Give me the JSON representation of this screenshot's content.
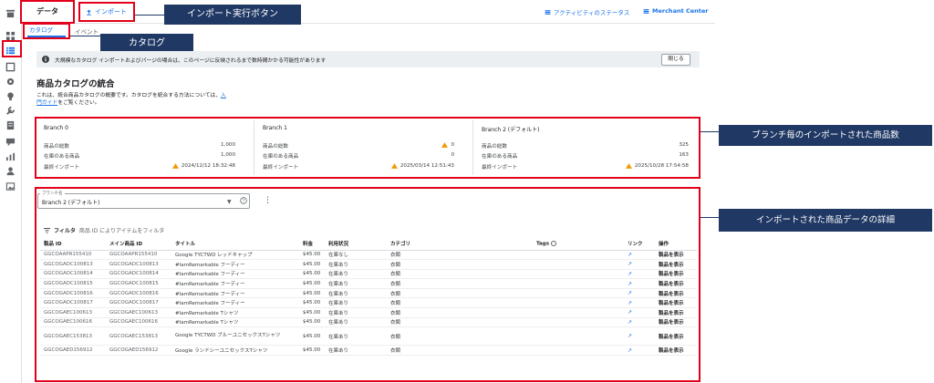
{
  "rail": {
    "icons": [
      "store-icon",
      "list-icon",
      "inbox-icon",
      "gear-icon",
      "lightbulb-icon",
      "wrench-icon",
      "document-icon",
      "chat-icon",
      "chart-icon",
      "person-icon",
      "image-icon"
    ]
  },
  "header": {
    "title": "データ",
    "import_label": "インポート",
    "activity_status": "アクティビティのステータス",
    "merchant_center": "Merchant Center"
  },
  "tabs": [
    {
      "label": "カタログ"
    },
    {
      "label": "イベント"
    }
  ],
  "callouts": {
    "import": "インポート実行ボタン",
    "catalog": "カタログ",
    "branch": "ブランチ毎のインポートされた商品数",
    "detail": "インポートされた商品データの詳細"
  },
  "banner": {
    "text": "大規模なカタログ インポートおよびパージの場合は、このページに反映されるまで数時間かかる可能性があります",
    "close": "閉じる"
  },
  "section": {
    "title": "商品カタログの統合",
    "desc_prefix": "これは、統合商品カタログの概要です。カタログを統合する方法については、",
    "link1": "入",
    "link2": "門ガイド",
    "desc_suffix": "をご覧ください。"
  },
  "branches": [
    {
      "name": "Branch 0",
      "total_label": "商品の総数",
      "total": "1,000",
      "instock_label": "在庫のある商品",
      "instock": "1,000",
      "last_label": "最終インポート",
      "last": "2024/12/12 18:32:48",
      "total_warn": false,
      "last_warn": true
    },
    {
      "name": "Branch 1",
      "total_label": "商品の総数",
      "total": "0",
      "instock_label": "在庫のある商品",
      "instock": "0",
      "last_label": "最終インポート",
      "last": "2025/03/14 12:51:43",
      "total_warn": true,
      "last_warn": true
    },
    {
      "name": "Branch 2 (デフォルト)",
      "total_label": "商品の総数",
      "total": "325",
      "instock_label": "在庫のある商品",
      "instock": "163",
      "last_label": "最終インポート",
      "last": "2025/10/28 17:54:58",
      "total_warn": false,
      "last_warn": true
    }
  ],
  "selector": {
    "label": "ブランチ名",
    "value": "Branch 2 (デフォルト)"
  },
  "filter": {
    "label": "フィルタ",
    "hint": "商品 ID によりアイテムをフィルタ"
  },
  "table": {
    "columns": [
      "製品 ID",
      "メイン商品 ID",
      "タイトル",
      "料金",
      "利用状況",
      "カテゴリ",
      "Tags",
      "リンク",
      "操作"
    ],
    "rows": [
      [
        "GGCOAAPR155410",
        "GGCOAAPR155410",
        "Google TYCTWD レッドキャップ",
        "$45.00",
        "在庫なし",
        "衣類",
        "",
        "",
        "製品を表示"
      ],
      [
        "GGCOGADC100813",
        "GGCOGADC100813",
        "#IamRemarkable フーディー",
        "$45.00",
        "在庫あり",
        "衣類",
        "",
        "",
        "製品を表示"
      ],
      [
        "GGCOGADC100814",
        "GGCOGADC100814",
        "#IamRemarkable フーディー",
        "$45.00",
        "在庫あり",
        "衣類",
        "",
        "",
        "製品を表示"
      ],
      [
        "GGCOGADC100815",
        "GGCOGADC100815",
        "#IamRemarkable フーディー",
        "$45.00",
        "在庫あり",
        "衣類",
        "",
        "",
        "製品を表示"
      ],
      [
        "GGCOGADC100816",
        "GGCOGADC100816",
        "#IamRemarkable フーディー",
        "$45.00",
        "在庫あり",
        "衣類",
        "",
        "",
        "製品を表示"
      ],
      [
        "GGCOGADC100817",
        "GGCOGADC100817",
        "#IamRemarkable フーディー",
        "$45.00",
        "在庫あり",
        "衣類",
        "",
        "",
        "製品を表示"
      ],
      [
        "GGCOGAEC100613",
        "GGCOGAEC100613",
        "#IamRemarkable Tシャツ",
        "$45.00",
        "在庫あり",
        "衣類",
        "",
        "",
        "製品を表示"
      ],
      [
        "GGCOGAEC100616",
        "GGCOGAEC100616",
        "#IamRemarkable Tシャツ",
        "$45.00",
        "在庫あり",
        "衣類",
        "",
        "",
        "製品を表示"
      ],
      [
        "GGCOGAEC153813",
        "GGCOGAEC153813",
        "Google TYCTWD ブルーユニセックスTシャツ",
        "$45.00",
        "在庫あり",
        "衣類",
        "",
        "",
        "製品を表示"
      ],
      [
        "GGCOGAED156912",
        "GGCOGAED156912",
        "Google ランドシーユニセックスTシャツ",
        "$45.00",
        "在庫あり",
        "衣類",
        "",
        "",
        "製品を表示"
      ]
    ]
  },
  "colors": {
    "accent": "#1a73e8",
    "highlight": "#e2001a",
    "callout": "#203864",
    "warning": "#f29900"
  }
}
